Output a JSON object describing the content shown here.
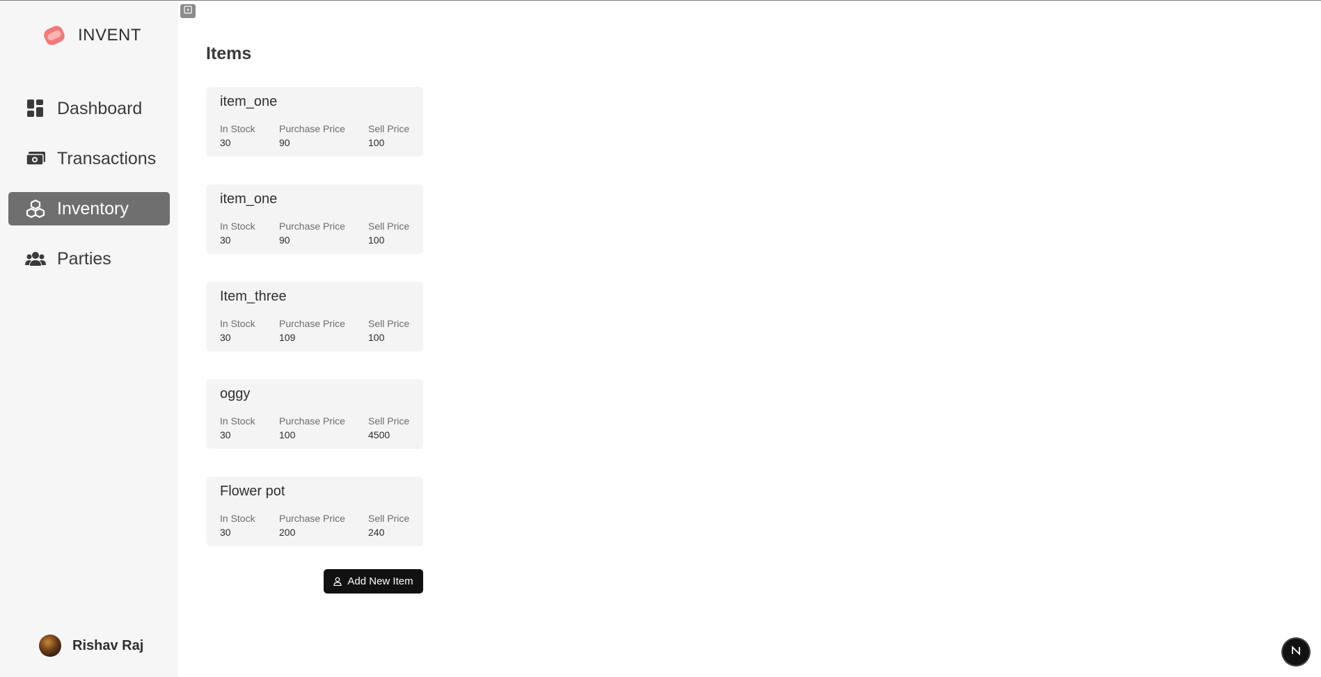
{
  "app": {
    "brand_name": "INVENT",
    "user_name": "Rishav Raj"
  },
  "sidebar": {
    "items": [
      {
        "label": "Dashboard",
        "icon": "dashboard-grid-icon",
        "active": false
      },
      {
        "label": "Transactions",
        "icon": "money-bills-icon",
        "active": false
      },
      {
        "label": "Inventory",
        "icon": "cubes-icon",
        "active": true
      },
      {
        "label": "Parties",
        "icon": "users-group-icon",
        "active": false
      }
    ]
  },
  "main": {
    "title": "Items",
    "columns": {
      "stock": "In Stock",
      "purchase": "Purchase Price",
      "sell": "Sell Price"
    },
    "items": [
      {
        "name": "item_one",
        "stock": "30",
        "purchase": "90",
        "sell": "100"
      },
      {
        "name": "item_one",
        "stock": "30",
        "purchase": "90",
        "sell": "100"
      },
      {
        "name": "Item_three",
        "stock": "30",
        "purchase": "109",
        "sell": "100"
      },
      {
        "name": "oggy",
        "stock": "30",
        "purchase": "100",
        "sell": "4500"
      },
      {
        "name": "Flower pot",
        "stock": "30",
        "purchase": "200",
        "sell": "240"
      }
    ],
    "add_button_label": "Add New Item"
  },
  "colors": {
    "sidebar_bg": "#f6f6f6",
    "active_nav_bg": "#6f6f6f",
    "card_bg": "#f4f4f4",
    "button_bg": "#111111",
    "brand_logo": "#f07a7a"
  }
}
